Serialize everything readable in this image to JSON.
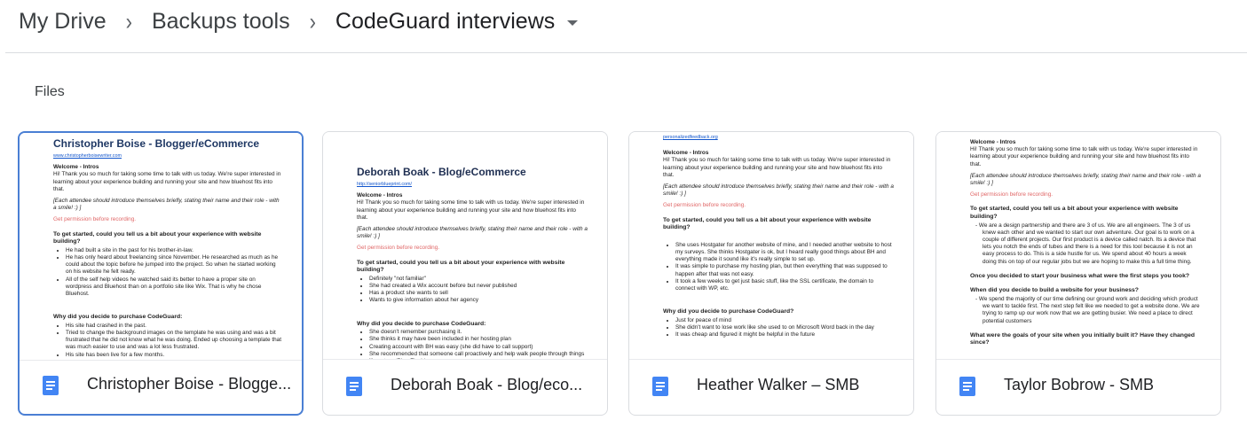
{
  "breadcrumb": {
    "items": [
      "My Drive",
      "Backups tools",
      "CodeGuard interviews"
    ]
  },
  "section": {
    "label": "Files"
  },
  "files": [
    {
      "title": "Christopher Boise - Blogge...",
      "doc_heading": "Christopher Boise - Blogger/eCommerce",
      "doc_link": "www.christopherboisewriter.com",
      "welcome": "Welcome - Intros",
      "intro": "Hi! Thank you so much for taking some time to talk with us today. We're super interested in learning about your experience building and running your site and how bluehost fits into that.",
      "italic": "[Each attendee should introduce themselves briefly, stating their name and their role - with a smile! :) ]",
      "red": "Get permission before recording.",
      "q1": "To get started, could you tell us a bit about your experience with website building?",
      "q1_bullets": [
        "He had built a site in the past for his brother-in-law.",
        "He has only heard about freelancing since November. He researched as much as he could about the topic before he jumped into the project. So when he started working on his website he felt ready.",
        "All of the self help videos he watched said its better to have a proper site on wordpress and Bluehost than on a portfolio site like Wix. That is why he chose Bluehost."
      ],
      "q2": "Why did you decide to purchase CodeGuard:",
      "q2_bullets": [
        "His site had crashed in the past.",
        "Tried to change the background images on the template he was using and was a bit frustrated that he did not know what he was doing. Ended up choosing a template that was much easier to use and was a lot less frustrated.",
        "His site has been live for a few months."
      ]
    },
    {
      "title": "Deborah Boak - Blog/eco...",
      "doc_heading": "Deborah Boak - Blog/eCommerce",
      "doc_link": "http://seniorblueprint.com/",
      "welcome": "Welcome - Intros",
      "intro": "Hi! Thank you so much for taking some time to talk with us today. We're super interested in learning about your experience building and running your site and how bluehost fits into that.",
      "italic": "[Each attendee should introduce themselves briefly, stating their name and their role - with a smile! :) ]",
      "red": "Get permission before recording.",
      "q1": "To get started, could you tell us a bit about your experience with website building?",
      "q1_bullets": [
        "Definitely \"not familiar\"",
        "She had created a Wix account before but never published",
        "Has a product she wants to sell",
        "Wants to give information about her agency"
      ],
      "q2": "Why did you decide to purchase CodeGuard:",
      "q2_bullets": [
        "She doesn't remember purchasing it.",
        "She thinks it may have been included in her hosting plan",
        "Creating account with BH was easy (she did have to call support)",
        "She recommended that someone call proactively and help walk people through things like a tour (Blue Flash)"
      ]
    },
    {
      "title": "Heather Walker – SMB",
      "doc_link": "personalizedfeedback.org",
      "welcome": "Welcome - Intros",
      "intro": "Hi! Thank you so much for taking some time to talk with us today. We're super interested in learning about your experience building and running your site and how bluehost fits into that.",
      "italic": "[Each attendee should introduce themselves briefly, stating their name and their role - with a smile! :) ]",
      "red": "Get permission before recording.",
      "q1": "To get started, could you tell us a bit about your experience with website building?",
      "q1_bullets": [
        "She uses Hostgater for another website of mine, and I needed another website to host my surveys. She thinks Hostgater is ok, but I heard really good things about BH and everything made it sound like it's really simple to set up.",
        "It was simple to purchase my hosting plan, but then everything that was supposed to happen after that was not easy.",
        "It took a few weeks to get just basic stuff, like the SSL certificate, the domain to connect with WP, etc."
      ],
      "q2": "Why did you decide to purchase CodeGuard?",
      "q2_bullets": [
        "Just for peace of mind",
        "She didn't want to lose work like she used to on Microsoft Word back in the day",
        "It was cheap and figured it might be helpful in the future"
      ]
    },
    {
      "title": "Taylor Bobrow - SMB",
      "welcome": "Welcome - Intros",
      "intro": "Hi! Thank you so much for taking some time to talk with us today. We're super interested in learning about your experience building and running your site and how bluehost fits into that.",
      "italic": "[Each attendee should introduce themselves briefly, stating their name and their role - with a smile! :) ]",
      "red": "Get permission before recording.",
      "q1": "To get started, could you tell us a bit about your experience with website building?",
      "q1_bullets": [
        "We are a design partnership and there are 3 of us. We are all engineers. The 3 of us knew each other and we wanted to start our own adventure. Our goal is to work on a couple of different projects. Our first product is a device called natch. Its a device that lets you notch the ends of tubes and there is a need for this tool because it is not an easy process to do. This is a side hustle for us. We spend about 40 hours a week doing this on top of our regular jobs but we are hoping to make this a full time thing."
      ],
      "q2": "Once you decided to start your business what were the first steps you took?",
      "q3": "When did you decide to build a website for your business?",
      "q3_bullets": [
        "We spend the majority of our time defining our ground work and deciding which product we want to tackle first. The next step felt like we needed to get a website done. We are trying to ramp up our work now that we are getting busier. We need a place to direct potential customers"
      ],
      "q4": "What were the goals of your site when you initially built it? Have they changed since?"
    }
  ],
  "colors": {
    "selected_border": "#4a7fd4",
    "doc_icon": "#4285f4",
    "heading": "#1f3864",
    "red_text": "#e06666"
  }
}
